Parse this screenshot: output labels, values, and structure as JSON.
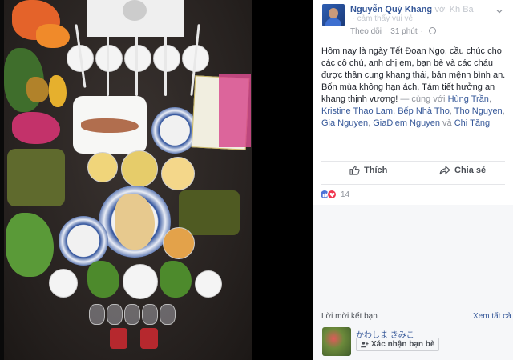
{
  "post": {
    "author_name": "Nguyễn Quý Khang",
    "author_extra_faded": "~ với Kh Ba",
    "author_line2_faded": "~ cảm thấy vui vẻ",
    "follow_label": "Theo dõi",
    "time": "31 phút",
    "text_main": "Hôm nay là ngày Tết Đoan Ngọ, cầu chúc cho các cô chú, anh chị em, bạn bè và các cháu được thân cung khang thái, bản mệnh bình an. Bốn mùa không hạn ách, Tám tiết hưởng an khang thịnh vượng!",
    "with_prefix": "— cùng với",
    "tagged_people": [
      "Hùng Trần",
      "Kristine Thao Lam",
      "Bếp Nhà Tho",
      "Tho Nguyen",
      "Gia Nguyen",
      "GiaDiem Nguyen"
    ],
    "and_word": "và",
    "last_person": "Chi Tăng",
    "like_label": "Thích",
    "share_label": "Chia sẻ",
    "reaction_count": "14"
  },
  "friend_requests": {
    "title": "Lời mời kết bạn",
    "see_all": "Xem tất cả",
    "name": "かわしま きみこ",
    "confirm_label": "Xác nhận bạn bè"
  },
  "icons": {
    "globe": "globe-icon",
    "like": "thumbs-up-icon",
    "share": "share-arrow-icon",
    "chevron": "chevron-down-icon",
    "add_friend": "add-friend-icon"
  },
  "colors": {
    "link": "#365899",
    "meta": "#90949c",
    "like_reaction": "#4d74d8",
    "love_reaction": "#f0364f"
  }
}
